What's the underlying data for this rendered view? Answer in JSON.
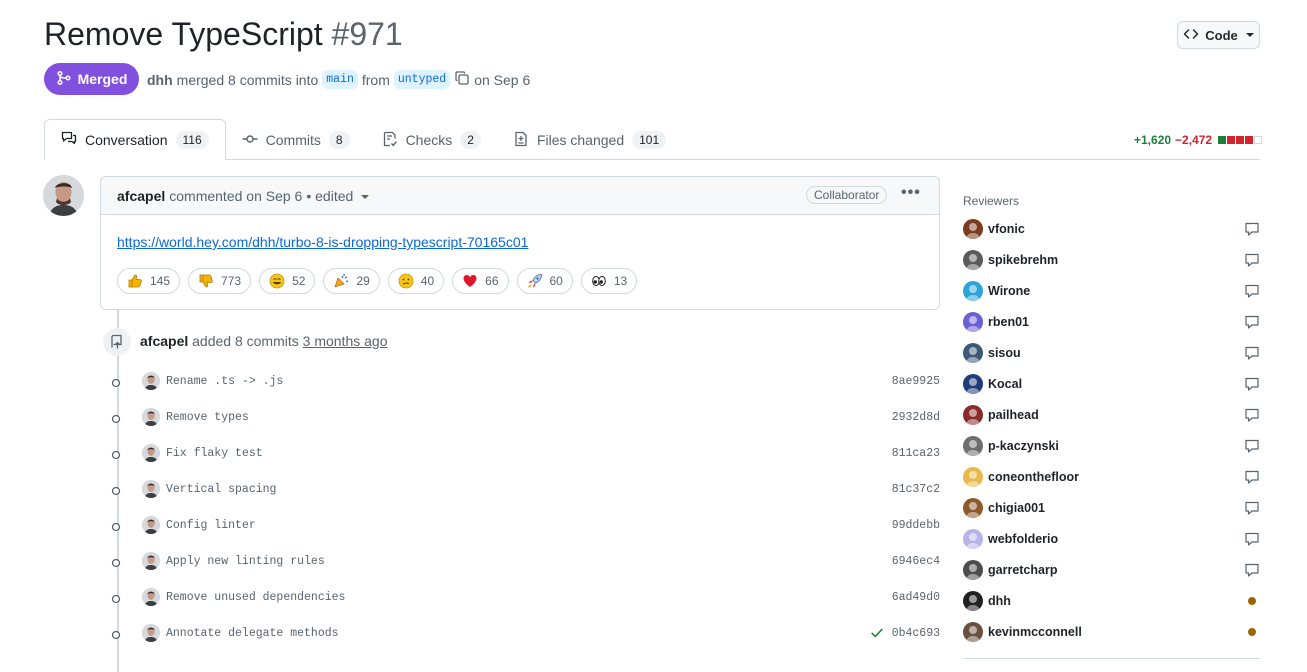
{
  "header": {
    "title": "Remove TypeScript",
    "number": "#971",
    "code_button": "Code",
    "state": "Merged",
    "author": "dhh",
    "merged_text": "merged 8 commits into",
    "base_branch": "main",
    "from_text": "from",
    "head_branch": "untyped",
    "date_text": "on Sep 6"
  },
  "tabs": [
    {
      "label": "Conversation",
      "count": "116",
      "icon": "comment-discussion-icon"
    },
    {
      "label": "Commits",
      "count": "8",
      "icon": "git-commit-icon"
    },
    {
      "label": "Checks",
      "count": "2",
      "icon": "checklist-icon"
    },
    {
      "label": "Files changed",
      "count": "101",
      "icon": "file-diff-icon"
    }
  ],
  "diffstat": {
    "additions": "+1,620",
    "deletions": "−2,472",
    "colors": {
      "add": "#1a7f37",
      "del": "#d1242f",
      "neutral": "#d1d9e0"
    }
  },
  "comment": {
    "author": "afcapel",
    "action": "commented on Sep 6",
    "edited": "• edited",
    "role": "Collaborator",
    "more": "•••",
    "link": "https://world.hey.com/dhh/turbo-8-is-dropping-typescript-70165c01",
    "reactions": [
      {
        "emoji": "thumbs-up",
        "count": "145"
      },
      {
        "emoji": "thumbs-down",
        "count": "773"
      },
      {
        "emoji": "laugh",
        "count": "52"
      },
      {
        "emoji": "hooray",
        "count": "29"
      },
      {
        "emoji": "confused",
        "count": "40"
      },
      {
        "emoji": "heart",
        "count": "66"
      },
      {
        "emoji": "rocket",
        "count": "60"
      },
      {
        "emoji": "eyes",
        "count": "13"
      }
    ]
  },
  "push_event": {
    "author": "afcapel",
    "action": "added 8 commits",
    "ago": "3 months ago"
  },
  "commits": [
    {
      "message": "Rename .ts -> .js",
      "sha": "8ae9925",
      "check": false
    },
    {
      "message": "Remove types",
      "sha": "2932d8d",
      "check": false
    },
    {
      "message": "Fix flaky test",
      "sha": "811ca23",
      "check": false
    },
    {
      "message": "Vertical spacing",
      "sha": "81c37c2",
      "check": false
    },
    {
      "message": "Config linter",
      "sha": "99ddebb",
      "check": false
    },
    {
      "message": "Apply new linting rules",
      "sha": "6946ec4",
      "check": false
    },
    {
      "message": "Remove unused dependencies",
      "sha": "6ad49d0",
      "check": false
    },
    {
      "message": "Annotate delegate methods",
      "sha": "0b4c693",
      "check": true
    }
  ],
  "sidebar": {
    "reviewers_title": "Reviewers",
    "reviewers": [
      {
        "name": "vfonic",
        "status": "commented",
        "avatar_color": "#7a3b1f"
      },
      {
        "name": "spikebrehm",
        "status": "commented",
        "avatar_color": "#5b5b5b"
      },
      {
        "name": "Wirone",
        "status": "commented",
        "avatar_color": "#2aa4d9"
      },
      {
        "name": "rben01",
        "status": "commented",
        "avatar_color": "#6b5fd6"
      },
      {
        "name": "sisou",
        "status": "commented",
        "avatar_color": "#3c5a78"
      },
      {
        "name": "Kocal",
        "status": "commented",
        "avatar_color": "#1f3d7a"
      },
      {
        "name": "pailhead",
        "status": "commented",
        "avatar_color": "#8a2a2a"
      },
      {
        "name": "p-kaczynski",
        "status": "commented",
        "avatar_color": "#6e6e6e"
      },
      {
        "name": "coneonthefloor",
        "status": "commented",
        "avatar_color": "#e8b84a"
      },
      {
        "name": "chigia001",
        "status": "commented",
        "avatar_color": "#8c5a2b"
      },
      {
        "name": "webfolderio",
        "status": "commented",
        "avatar_color": "#b7b3e8"
      },
      {
        "name": "garretcharp",
        "status": "commented",
        "avatar_color": "#4d4d4d"
      },
      {
        "name": "dhh",
        "status": "pending",
        "avatar_color": "#222222"
      },
      {
        "name": "kevinmcconnell",
        "status": "pending",
        "avatar_color": "#6b5040"
      }
    ],
    "pending_color": "#9a6700"
  }
}
